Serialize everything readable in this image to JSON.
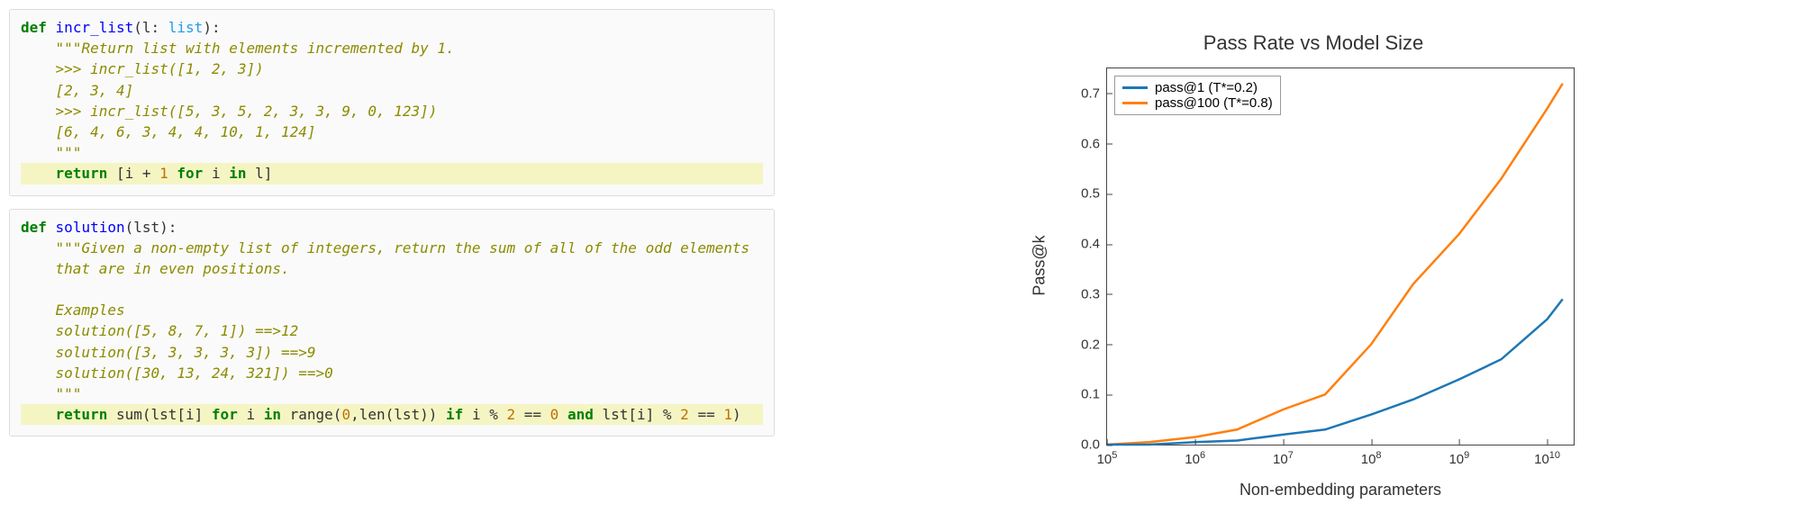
{
  "code": {
    "block1": {
      "def": "def",
      "name": "incr_list",
      "sig_open": "(l: ",
      "type": "list",
      "sig_close": "):",
      "doc_open": "\"\"\"",
      "doc1": "Return list with elements incremented by 1.",
      "doc2": ">>> incr_list([1, 2, 3])",
      "doc3": "[2, 3, 4]",
      "doc4": ">>> incr_list([5, 3, 5, 2, 3, 3, 9, 0, 123])",
      "doc5": "[6, 4, 6, 3, 4, 4, 10, 1, 124]",
      "doc_close": "\"\"\"",
      "ret": "return",
      "body_a": " [i + ",
      "body_num": "1",
      "body_b": " ",
      "body_for": "for",
      "body_c": " i ",
      "body_in": "in",
      "body_d": " l]"
    },
    "block2": {
      "def": "def",
      "name": "solution",
      "sig": "(lst):",
      "doc_open": "\"\"\"",
      "doc1": "Given a non-empty list of integers, return the sum of all of the odd elements",
      "doc2": "that are in even positions.",
      "doc_blank": "",
      "doc3": "Examples",
      "doc4": "solution([5, 8, 7, 1]) ==>12",
      "doc5": "solution([3, 3, 3, 3, 3]) ==>9",
      "doc6": "solution([30, 13, 24, 321]) ==>0",
      "doc_close": "\"\"\"",
      "ret": "return",
      "b1": " sum(lst[i] ",
      "for": "for",
      "b2": " i ",
      "in": "in",
      "b3": " range(",
      "n0": "0",
      "b4": ",len(lst)) ",
      "if": "if",
      "b5": " i % ",
      "n2a": "2",
      "b6": " == ",
      "n0b": "0",
      "b7": " ",
      "and": "and",
      "b8": " lst[i] % ",
      "n2b": "2",
      "b9": " == ",
      "n1": "1",
      "b10": ")"
    }
  },
  "chart": {
    "title": "Pass Rate vs Model Size",
    "ylabel": "Pass@k",
    "xlabel": "Non-embedding parameters",
    "legend": {
      "s1": "pass@1 (T*=0.2)",
      "s2": "pass@100 (T*=0.8)"
    },
    "colors": {
      "s1": "#1f77b4",
      "s2": "#ff7f0e"
    },
    "yticks": [
      "0.0",
      "0.1",
      "0.2",
      "0.3",
      "0.4",
      "0.5",
      "0.6",
      "0.7"
    ],
    "xtick_exp": [
      "5",
      "6",
      "7",
      "8",
      "9",
      "10"
    ]
  },
  "chart_data": {
    "type": "line",
    "title": "Pass Rate vs Model Size",
    "xlabel": "Non-embedding parameters",
    "ylabel": "Pass@k",
    "xscale": "log",
    "xlim": [
      100000.0,
      20000000000.0
    ],
    "ylim": [
      0.0,
      0.75
    ],
    "xticks": [
      100000.0,
      1000000.0,
      10000000.0,
      100000000.0,
      1000000000.0,
      10000000000.0
    ],
    "x": [
      100000.0,
      300000.0,
      1000000.0,
      3000000.0,
      10000000.0,
      30000000.0,
      100000000.0,
      300000000.0,
      1000000000.0,
      3000000000.0,
      10000000000.0,
      15000000000.0
    ],
    "series": [
      {
        "name": "pass@1 (T*=0.2)",
        "color": "#1f77b4",
        "values": [
          0.0,
          0.0,
          0.005,
          0.008,
          0.02,
          0.03,
          0.06,
          0.09,
          0.13,
          0.17,
          0.25,
          0.29
        ]
      },
      {
        "name": "pass@100 (T*=0.8)",
        "color": "#ff7f0e",
        "values": [
          0.0,
          0.005,
          0.015,
          0.03,
          0.07,
          0.1,
          0.2,
          0.32,
          0.42,
          0.53,
          0.67,
          0.72
        ]
      }
    ],
    "legend_position": "upper left",
    "grid": false
  }
}
